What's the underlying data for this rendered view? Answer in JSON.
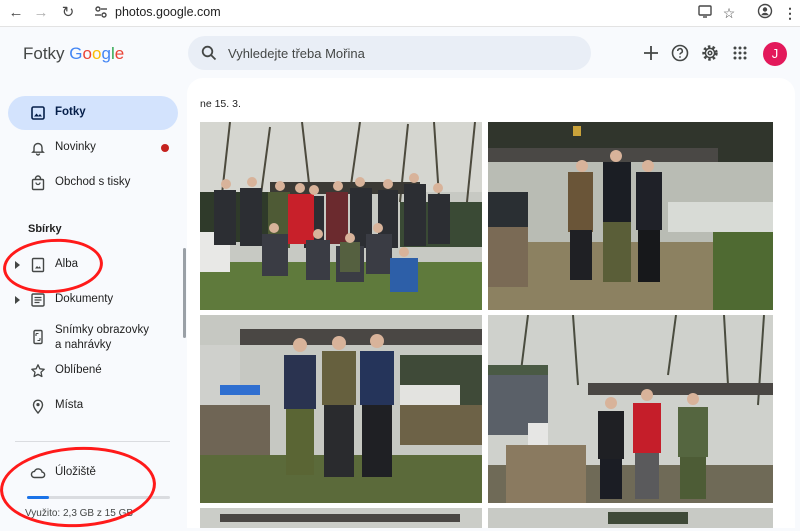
{
  "browser": {
    "url": "photos.google.com"
  },
  "app": {
    "logo_prefix": "Fotky",
    "logo_google": [
      "G",
      "o",
      "o",
      "g",
      "l",
      "e"
    ],
    "search_placeholder": "Vyhledejte třeba Mořina",
    "avatar_letter": "J"
  },
  "sidebar": {
    "items": [
      {
        "label": "Fotky"
      },
      {
        "label": "Novinky"
      },
      {
        "label": "Obchod s tisky"
      }
    ],
    "section_title": "Sbírky",
    "collections": [
      {
        "label": "Alba"
      },
      {
        "label": "Dokumenty"
      },
      {
        "label_line1": "Snímky obrazovky",
        "label_line2": "a nahrávky"
      },
      {
        "label": "Oblíbené"
      },
      {
        "label": "Místa"
      }
    ],
    "storage": {
      "label": "Úložiště",
      "text": "Využito: 2,3 GB z 15 GB",
      "used_fraction": 0.153
    }
  },
  "main": {
    "date_label": "ne 15. 3."
  },
  "colors": {
    "accent": "#1a73e8",
    "active_bg": "#d3e3fd",
    "avatar": "#e3195b",
    "annotation": "#ff1a1a"
  }
}
